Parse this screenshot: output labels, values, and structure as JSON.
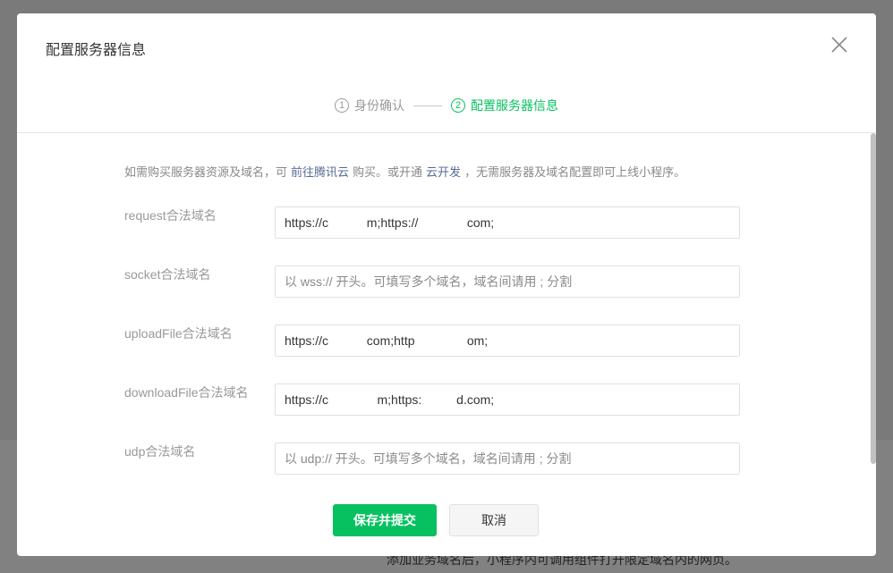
{
  "background": {
    "hint_text": "添加业务域名后，小程序内可调用组件打开限定域名内的网页。"
  },
  "dialog": {
    "title": "配置服务器信息",
    "steps": [
      {
        "number": "1",
        "label": "身份确认"
      },
      {
        "number": "2",
        "label": "配置服务器信息"
      }
    ],
    "notice": {
      "prefix": "如需购买服务器资源及域名，可",
      "link1": "前往腾讯云",
      "middle": "购买。或开通",
      "link2": "云开发",
      "suffix": "，无需服务器及域名配置即可上线小程序。"
    },
    "fields": [
      {
        "label": "request合法域名",
        "value": "https://c           m;https://              com;",
        "placeholder": ""
      },
      {
        "label": "socket合法域名",
        "value": "",
        "placeholder": "以 wss:// 开头。可填写多个域名，域名间请用 ; 分割"
      },
      {
        "label": "uploadFile合法域名",
        "value": "https://c           com;http               om;",
        "placeholder": ""
      },
      {
        "label": "downloadFile合法域名",
        "value": "https://c              m;https:          d.com;",
        "placeholder": ""
      },
      {
        "label": "udp合法域名",
        "value": "",
        "placeholder": "以 udp:// 开头。可填写多个域名，域名间请用 ; 分割"
      }
    ],
    "buttons": {
      "save": "保存并提交",
      "cancel": "取消"
    }
  },
  "colors": {
    "accent": "#07c160",
    "link": "#576b95"
  }
}
